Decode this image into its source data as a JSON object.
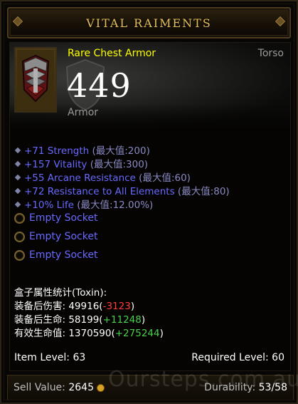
{
  "title": "VITAL RAIMENTS",
  "item": {
    "type": "Rare Chest Armor",
    "slot": "Torso",
    "armor_value": "449",
    "armor_label": "Armor",
    "icon": "chest-armor-icon"
  },
  "affixes": [
    {
      "value": "+71 Strength",
      "max": "(最大值:200)"
    },
    {
      "value": "+157 Vitality",
      "max": "(最大值:300)"
    },
    {
      "value": "+55 Arcane Resistance",
      "max": "(最大值:60)"
    },
    {
      "value": "+72 Resistance to All Elements",
      "max": "(最大值:80)"
    },
    {
      "value": "+10% Life",
      "max": "(最大值:12.00%)"
    }
  ],
  "sockets": [
    "Empty Socket",
    "Empty Socket",
    "Empty Socket"
  ],
  "stats": {
    "header": "盒子属性统计(Toxin):",
    "damage_label": "装备后伤害: ",
    "damage_value": "49916",
    "damage_delta": "-3123",
    "life_label": "装备后生命: ",
    "life_value": "58199",
    "life_delta": "+11248",
    "ehp_label": "有效生命值: ",
    "ehp_value": "1370590",
    "ehp_delta": "+275244"
  },
  "item_level": "Item Level: 63",
  "required_level": "Required Level: 60",
  "sell_label": "Sell Value: ",
  "sell_value": "2645",
  "durability_label": "Durability: ",
  "durability_value": "53/58",
  "watermark": "Oursteps.com.au",
  "colors": {
    "title": "#e3c05a",
    "rare": "#ffff00",
    "magic": "#6969ff",
    "negative": "#ff3a3a",
    "positive": "#4ccf4c"
  }
}
